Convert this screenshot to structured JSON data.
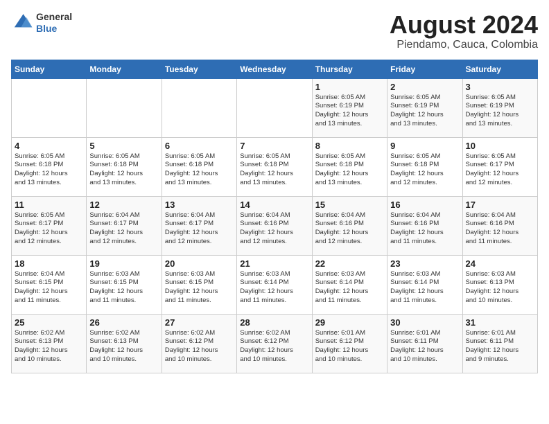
{
  "header": {
    "logo_line1": "General",
    "logo_line2": "Blue",
    "month_year": "August 2024",
    "location": "Piendamo, Cauca, Colombia"
  },
  "days_of_week": [
    "Sunday",
    "Monday",
    "Tuesday",
    "Wednesday",
    "Thursday",
    "Friday",
    "Saturday"
  ],
  "weeks": [
    [
      {
        "day": "",
        "info": ""
      },
      {
        "day": "",
        "info": ""
      },
      {
        "day": "",
        "info": ""
      },
      {
        "day": "",
        "info": ""
      },
      {
        "day": "1",
        "info": "Sunrise: 6:05 AM\nSunset: 6:19 PM\nDaylight: 12 hours\nand 13 minutes."
      },
      {
        "day": "2",
        "info": "Sunrise: 6:05 AM\nSunset: 6:19 PM\nDaylight: 12 hours\nand 13 minutes."
      },
      {
        "day": "3",
        "info": "Sunrise: 6:05 AM\nSunset: 6:19 PM\nDaylight: 12 hours\nand 13 minutes."
      }
    ],
    [
      {
        "day": "4",
        "info": "Sunrise: 6:05 AM\nSunset: 6:18 PM\nDaylight: 12 hours\nand 13 minutes."
      },
      {
        "day": "5",
        "info": "Sunrise: 6:05 AM\nSunset: 6:18 PM\nDaylight: 12 hours\nand 13 minutes."
      },
      {
        "day": "6",
        "info": "Sunrise: 6:05 AM\nSunset: 6:18 PM\nDaylight: 12 hours\nand 13 minutes."
      },
      {
        "day": "7",
        "info": "Sunrise: 6:05 AM\nSunset: 6:18 PM\nDaylight: 12 hours\nand 13 minutes."
      },
      {
        "day": "8",
        "info": "Sunrise: 6:05 AM\nSunset: 6:18 PM\nDaylight: 12 hours\nand 13 minutes."
      },
      {
        "day": "9",
        "info": "Sunrise: 6:05 AM\nSunset: 6:18 PM\nDaylight: 12 hours\nand 12 minutes."
      },
      {
        "day": "10",
        "info": "Sunrise: 6:05 AM\nSunset: 6:17 PM\nDaylight: 12 hours\nand 12 minutes."
      }
    ],
    [
      {
        "day": "11",
        "info": "Sunrise: 6:05 AM\nSunset: 6:17 PM\nDaylight: 12 hours\nand 12 minutes."
      },
      {
        "day": "12",
        "info": "Sunrise: 6:04 AM\nSunset: 6:17 PM\nDaylight: 12 hours\nand 12 minutes."
      },
      {
        "day": "13",
        "info": "Sunrise: 6:04 AM\nSunset: 6:17 PM\nDaylight: 12 hours\nand 12 minutes."
      },
      {
        "day": "14",
        "info": "Sunrise: 6:04 AM\nSunset: 6:16 PM\nDaylight: 12 hours\nand 12 minutes."
      },
      {
        "day": "15",
        "info": "Sunrise: 6:04 AM\nSunset: 6:16 PM\nDaylight: 12 hours\nand 12 minutes."
      },
      {
        "day": "16",
        "info": "Sunrise: 6:04 AM\nSunset: 6:16 PM\nDaylight: 12 hours\nand 11 minutes."
      },
      {
        "day": "17",
        "info": "Sunrise: 6:04 AM\nSunset: 6:16 PM\nDaylight: 12 hours\nand 11 minutes."
      }
    ],
    [
      {
        "day": "18",
        "info": "Sunrise: 6:04 AM\nSunset: 6:15 PM\nDaylight: 12 hours\nand 11 minutes."
      },
      {
        "day": "19",
        "info": "Sunrise: 6:03 AM\nSunset: 6:15 PM\nDaylight: 12 hours\nand 11 minutes."
      },
      {
        "day": "20",
        "info": "Sunrise: 6:03 AM\nSunset: 6:15 PM\nDaylight: 12 hours\nand 11 minutes."
      },
      {
        "day": "21",
        "info": "Sunrise: 6:03 AM\nSunset: 6:14 PM\nDaylight: 12 hours\nand 11 minutes."
      },
      {
        "day": "22",
        "info": "Sunrise: 6:03 AM\nSunset: 6:14 PM\nDaylight: 12 hours\nand 11 minutes."
      },
      {
        "day": "23",
        "info": "Sunrise: 6:03 AM\nSunset: 6:14 PM\nDaylight: 12 hours\nand 11 minutes."
      },
      {
        "day": "24",
        "info": "Sunrise: 6:03 AM\nSunset: 6:13 PM\nDaylight: 12 hours\nand 10 minutes."
      }
    ],
    [
      {
        "day": "25",
        "info": "Sunrise: 6:02 AM\nSunset: 6:13 PM\nDaylight: 12 hours\nand 10 minutes."
      },
      {
        "day": "26",
        "info": "Sunrise: 6:02 AM\nSunset: 6:13 PM\nDaylight: 12 hours\nand 10 minutes."
      },
      {
        "day": "27",
        "info": "Sunrise: 6:02 AM\nSunset: 6:12 PM\nDaylight: 12 hours\nand 10 minutes."
      },
      {
        "day": "28",
        "info": "Sunrise: 6:02 AM\nSunset: 6:12 PM\nDaylight: 12 hours\nand 10 minutes."
      },
      {
        "day": "29",
        "info": "Sunrise: 6:01 AM\nSunset: 6:12 PM\nDaylight: 12 hours\nand 10 minutes."
      },
      {
        "day": "30",
        "info": "Sunrise: 6:01 AM\nSunset: 6:11 PM\nDaylight: 12 hours\nand 10 minutes."
      },
      {
        "day": "31",
        "info": "Sunrise: 6:01 AM\nSunset: 6:11 PM\nDaylight: 12 hours\nand 9 minutes."
      }
    ]
  ]
}
